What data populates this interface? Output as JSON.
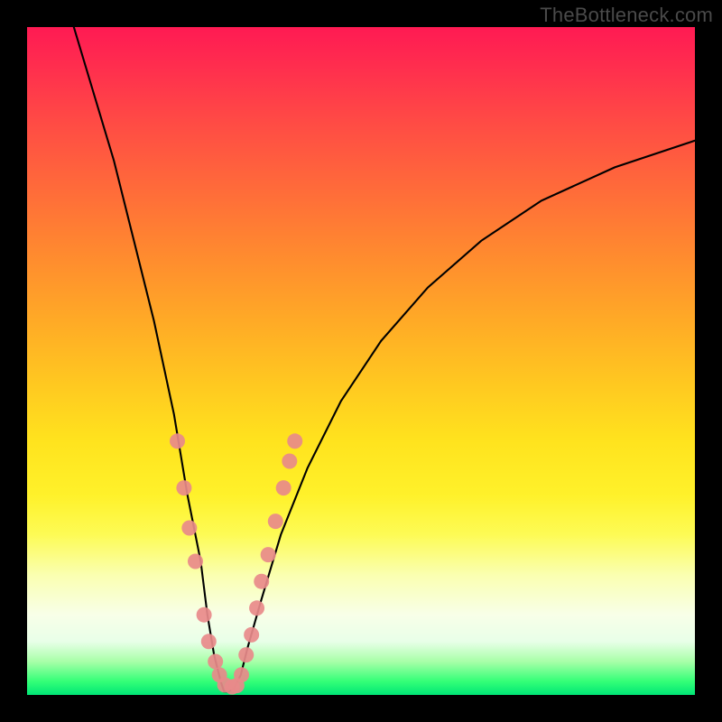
{
  "attribution": "TheBottleneck.com",
  "chart_data": {
    "type": "line",
    "title": "",
    "xlabel": "",
    "ylabel": "",
    "xlim": [
      0,
      100
    ],
    "ylim": [
      0,
      100
    ],
    "grid": false,
    "legend": false,
    "series": [
      {
        "name": "bottleneck-curve",
        "x": [
          7,
          10,
          13,
          16,
          19,
          22,
          24,
          26,
          27,
          28,
          29,
          29.5,
          30,
          31,
          32,
          33,
          35,
          38,
          42,
          47,
          53,
          60,
          68,
          77,
          88,
          100
        ],
        "y": [
          100,
          90,
          80,
          68,
          56,
          42,
          30,
          20,
          12,
          6,
          2,
          0.5,
          0.5,
          1,
          3,
          7,
          14,
          24,
          34,
          44,
          53,
          61,
          68,
          74,
          79,
          83
        ],
        "color": "#000000"
      }
    ],
    "markers": {
      "name": "data-points",
      "color": "#e88a8a",
      "x": [
        22.5,
        23.5,
        24.3,
        25.2,
        26.5,
        27.2,
        28.2,
        28.8,
        29.6,
        30.7,
        31.4,
        32.1,
        32.8,
        33.6,
        34.4,
        35.1,
        36.1,
        37.2,
        38.4,
        39.3,
        40.1
      ],
      "y": [
        38,
        31,
        25,
        20,
        12,
        8,
        5,
        3,
        1.5,
        1.2,
        1.4,
        3,
        6,
        9,
        13,
        17,
        21,
        26,
        31,
        35,
        38
      ]
    },
    "background_gradient": {
      "type": "vertical",
      "stops": [
        {
          "pos": 0,
          "color": "#ff1a53"
        },
        {
          "pos": 50,
          "color": "#ffd020"
        },
        {
          "pos": 88,
          "color": "#f8ffe8"
        },
        {
          "pos": 100,
          "color": "#00e676"
        }
      ]
    }
  }
}
